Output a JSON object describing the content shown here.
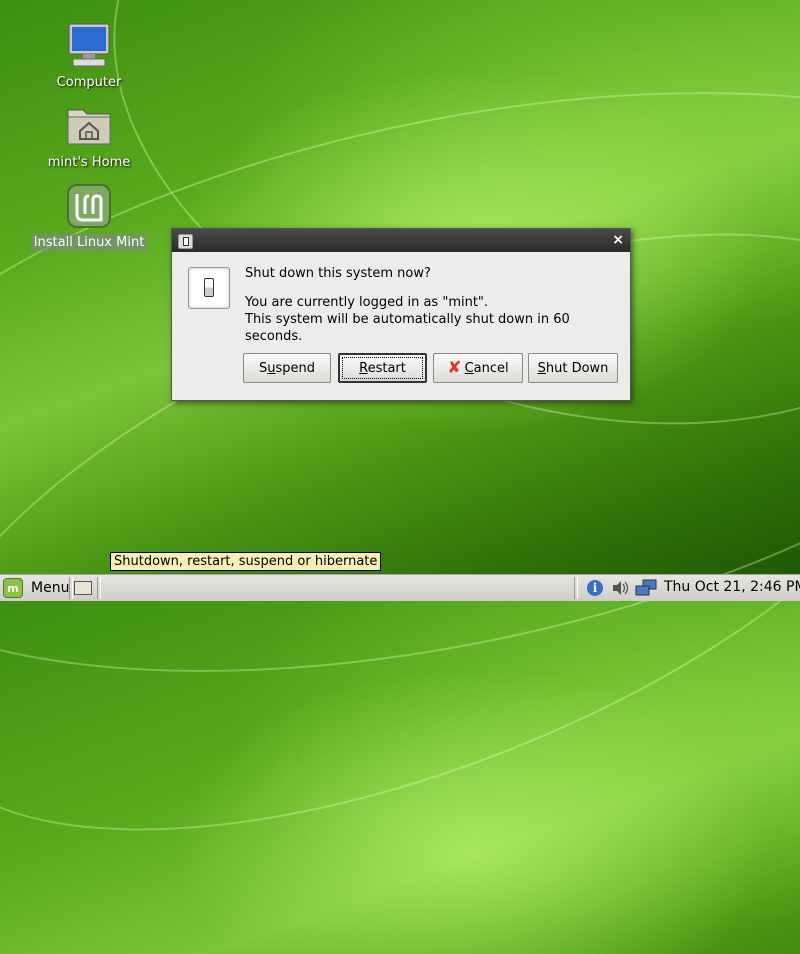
{
  "desktop": {
    "icons": [
      {
        "label": "Computer"
      },
      {
        "label": "mint's Home"
      },
      {
        "label": "Install Linux Mint"
      }
    ]
  },
  "dialog": {
    "close_glyph": "×",
    "heading": "Shut down this system now?",
    "message_line1": "You are currently logged in as \"mint\".",
    "message_line2": "This system will be automatically shut down in 60 seconds.",
    "buttons": {
      "suspend": {
        "pre": "S",
        "mnemonic": "u",
        "post": "spend"
      },
      "restart": {
        "pre": "",
        "mnemonic": "R",
        "post": "estart"
      },
      "cancel": {
        "pre": "",
        "mnemonic": "C",
        "post": "ancel",
        "icon": "✘"
      },
      "shutdown": {
        "pre": "",
        "mnemonic": "S",
        "post": "hut Down"
      }
    }
  },
  "tooltip": {
    "text": "Shutdown, restart, suspend or hibernate"
  },
  "panel": {
    "menu_label": "Menu",
    "clock": "Thu Oct 21,  2:46 PM",
    "accent": "#8bc34a"
  }
}
